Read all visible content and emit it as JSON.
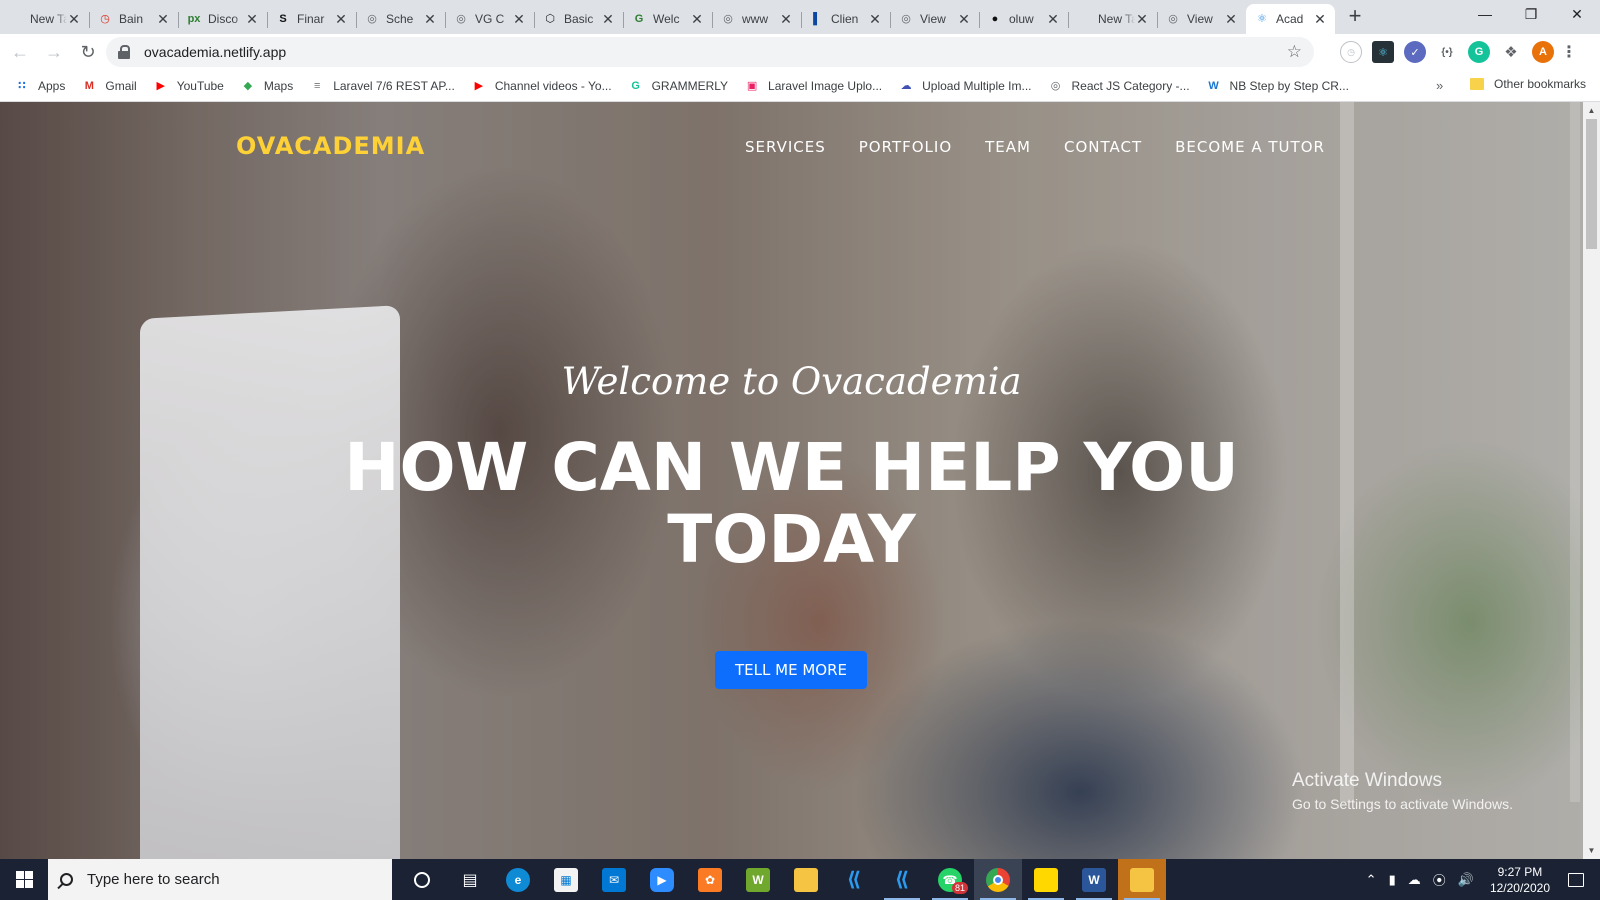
{
  "browser": {
    "tabs": [
      {
        "title": "New Tab",
        "icon": "none",
        "color": "#3c4043"
      },
      {
        "title": "Bain",
        "icon": "clock-icon",
        "color": "#d93025"
      },
      {
        "title": "Disco",
        "icon": "px-icon",
        "color": "#2e7d32"
      },
      {
        "title": "Finar",
        "icon": "s-icon",
        "color": "#111111"
      },
      {
        "title": "Sche",
        "icon": "globe-icon",
        "color": "#5f6368"
      },
      {
        "title": "VG C",
        "icon": "globe-icon",
        "color": "#5f6368"
      },
      {
        "title": "Basic",
        "icon": "hex-icon",
        "color": "#202124"
      },
      {
        "title": "Welc",
        "icon": "gnl-icon",
        "color": "#2e7d32"
      },
      {
        "title": "www",
        "icon": "globe-icon",
        "color": "#5f6368"
      },
      {
        "title": "Clien",
        "icon": "bracket-icon",
        "color": "#0d47a1"
      },
      {
        "title": "View",
        "icon": "globe-icon",
        "color": "#5f6368"
      },
      {
        "title": "oluw",
        "icon": "github-icon",
        "color": "#111111"
      },
      {
        "title": "New Tab",
        "icon": "none",
        "color": "#3c4043"
      },
      {
        "title": "View",
        "icon": "globe-icon",
        "color": "#5f6368"
      },
      {
        "title": "Acad",
        "icon": "react-icon",
        "color": "#1e88e5",
        "active": true
      }
    ],
    "url": "ovacademia.netlify.app",
    "profile_initial": "A",
    "bookmarks": [
      {
        "label": "Apps",
        "icon": "apps-grid-icon",
        "color": "#1a73e8"
      },
      {
        "label": "Gmail",
        "icon": "gmail-icon",
        "color": "#d93025"
      },
      {
        "label": "YouTube",
        "icon": "youtube-icon",
        "color": "#ff0000"
      },
      {
        "label": "Maps",
        "icon": "maps-icon",
        "color": "#34a853"
      },
      {
        "label": "Laravel 7/6 REST AP...",
        "icon": "laravel-icon",
        "color": "#777777"
      },
      {
        "label": "Channel videos - Yo...",
        "icon": "youtube-icon",
        "color": "#ff0000"
      },
      {
        "label": "GRAMMERLY",
        "icon": "grammarly-icon",
        "color": "#15c39a"
      },
      {
        "label": "Laravel Image Uplo...",
        "icon": "image-icon",
        "color": "#e91e63"
      },
      {
        "label": "Upload Multiple Im...",
        "icon": "cloud-icon",
        "color": "#3f51b5"
      },
      {
        "label": "React JS Category -...",
        "icon": "globe-icon",
        "color": "#5f6368"
      },
      {
        "label": "NB Step by Step CR...",
        "icon": "w-icon",
        "color": "#1976d2"
      }
    ],
    "other_bookmarks": "Other bookmarks"
  },
  "site": {
    "brand": "OVACADEMIA",
    "menu": [
      "SERVICES",
      "PORTFOLIO",
      "TEAM",
      "CONTACT",
      "BECOME A TUTOR"
    ],
    "hero_subheading": "Welcome to Ovacademia",
    "hero_heading_line1": "HOW CAN WE HELP YOU",
    "hero_heading_line2": "TODAY",
    "cta_label": "TELL ME MORE",
    "brand_color": "#fed136",
    "cta_color": "#0d6efd"
  },
  "watermark": {
    "title": "Activate Windows",
    "subtitle": "Go to Settings to activate Windows."
  },
  "taskbar": {
    "search_placeholder": "Type here to search",
    "time": "9:27 PM",
    "date": "12/20/2020",
    "whatsapp_badge": "81"
  }
}
